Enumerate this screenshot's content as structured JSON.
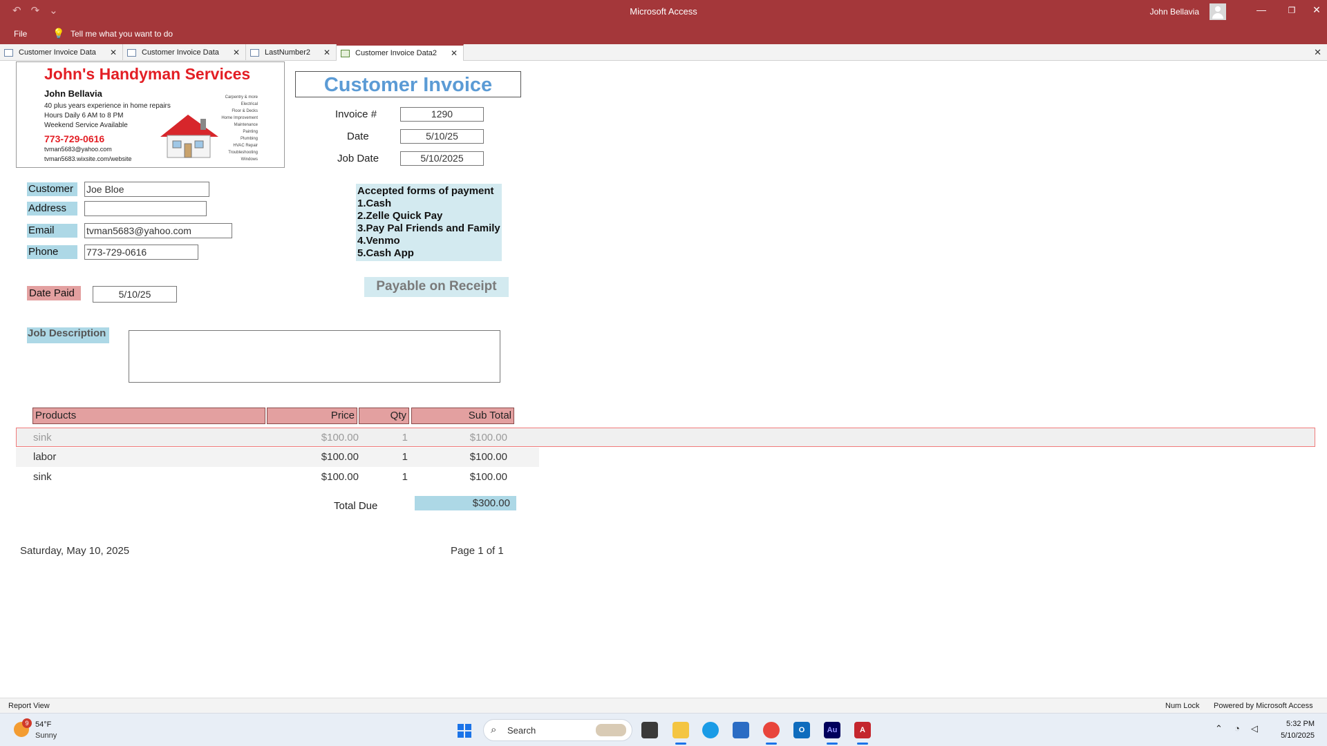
{
  "window": {
    "app_title": "Microsoft Access",
    "user_name": "John Bellavia",
    "controls": {
      "minimize": "—",
      "restore": "❐",
      "close": "✕"
    }
  },
  "qat": {
    "undo": "↶",
    "redo": "↷",
    "customize": "⌄"
  },
  "ribbon": {
    "file_label": "File",
    "tell_me": "Tell me what you want to do"
  },
  "tabs": [
    {
      "label": "Customer Invoice Data",
      "icon": "form-icon",
      "active": false
    },
    {
      "label": "Customer Invoice Data",
      "icon": "table-icon",
      "active": false
    },
    {
      "label": "LastNumber2",
      "icon": "table-icon",
      "active": false
    },
    {
      "label": "Customer Invoice Data2",
      "icon": "report-icon",
      "active": true
    }
  ],
  "tab_close": "✕",
  "business_card": {
    "name": "John's Handyman Services",
    "owner": "John Bellavia",
    "line1": "40 plus years experience in home repairs",
    "line2": "Hours Daily 6 AM to 8 PM",
    "line3": "Weekend Service Available",
    "phone": "773-729-0616",
    "email": "tvman5683@yahoo.com",
    "website": "tvman5683.wixsite.com/website",
    "services": [
      "Carpentry & more",
      "Electrical",
      "Floor & Decks",
      "Home Improvement",
      "Maintenance",
      "Painting",
      "Plumbing",
      "HVAC Repair",
      "Troubleshooting",
      "Windows"
    ]
  },
  "invoice": {
    "title": "Customer Invoice",
    "invoice_no_label": "Invoice #",
    "invoice_no": "1290",
    "date_label": "Date",
    "date": "5/10/25",
    "job_date_label": "Job Date",
    "job_date": "5/10/2025"
  },
  "customer": {
    "customer_label": "Customer",
    "customer": "Joe Bloe",
    "address_label": "Address",
    "address": "",
    "email_label": "Email",
    "email": "tvman5683@yahoo.com",
    "phone_label": "Phone",
    "phone": "773-729-0616"
  },
  "payment": {
    "heading": "Accepted forms of payment",
    "methods": [
      "1.Cash",
      "2.Zelle Quick Pay",
      "3.Pay Pal Friends and Family",
      "4.Venmo",
      "5.Cash App"
    ],
    "payable": "Payable on Receipt"
  },
  "date_paid": {
    "label": "Date Paid",
    "value": "5/10/25"
  },
  "job_description": {
    "label": "Job Description",
    "value": ""
  },
  "items_table": {
    "headers": {
      "products": "Products",
      "price": "Price",
      "qty": "Qty",
      "subtotal": "Sub Total"
    },
    "rows": [
      {
        "product": "sink",
        "price": "$100.00",
        "qty": "1",
        "subtotal": "$100.00"
      },
      {
        "product": "labor",
        "price": "$100.00",
        "qty": "1",
        "subtotal": "$100.00"
      },
      {
        "product": "sink",
        "price": "$100.00",
        "qty": "1",
        "subtotal": "$100.00"
      }
    ],
    "total_label": "Total Due",
    "total": "$300.00"
  },
  "report_footer": {
    "date": "Saturday, May 10, 2025",
    "page": "Page 1 of 1"
  },
  "statusbar": {
    "view": "Report View",
    "numlock": "Num Lock",
    "powered": "Powered by Microsoft Access"
  },
  "taskbar": {
    "weather_badge": "9",
    "weather_temp": "54°F",
    "weather_cond": "Sunny",
    "search_placeholder": "Search",
    "apps": [
      "file-explorer",
      "edge",
      "store",
      "chrome",
      "outlook",
      "audition",
      "access"
    ],
    "audition_glyph": "Au",
    "access_glyph": "A",
    "outlook_glyph": "O",
    "time": "5:32 PM",
    "date": "5/10/2025"
  },
  "colors": {
    "brand": "#a4373a",
    "label_blue": "#add8e6",
    "label_pink": "#e3a0a0",
    "title_blue": "#5b9bd5",
    "biz_red": "#e31e24"
  }
}
